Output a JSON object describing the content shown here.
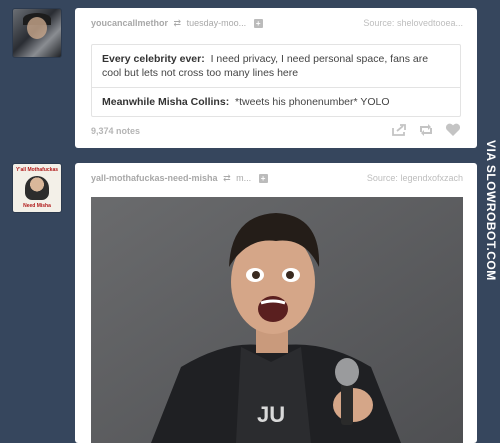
{
  "posts": [
    {
      "blog": "youcancallmethor",
      "reblogged_from": "tuesday-moo...",
      "source_label": "Source:",
      "source": "shelovedtooea...",
      "quote": [
        {
          "speaker": "Every celebrity ever:",
          "text": "I need privacy, I need personal space, fans are cool but lets not cross too many lines here"
        },
        {
          "speaker": "Meanwhile Misha Collins:",
          "text": "*tweets his phonenumber* YOLO"
        }
      ],
      "notes": "9,374 notes"
    },
    {
      "blog": "yall-mothafuckas-need-misha",
      "reblogged_from": "m...",
      "source_label": "Source:",
      "source": "legendxofxzach",
      "avatar_top": "Y'all Mothafuckas",
      "avatar_bottom": "Need Misha"
    }
  ],
  "watermark": "VIA SLOWROBOT.COM",
  "colors": {
    "background": "#36465d",
    "card": "#ffffff",
    "meta": "#a8a8a8"
  },
  "icons": [
    "reblog-icon",
    "plus-icon",
    "share-icon",
    "like-icon"
  ]
}
